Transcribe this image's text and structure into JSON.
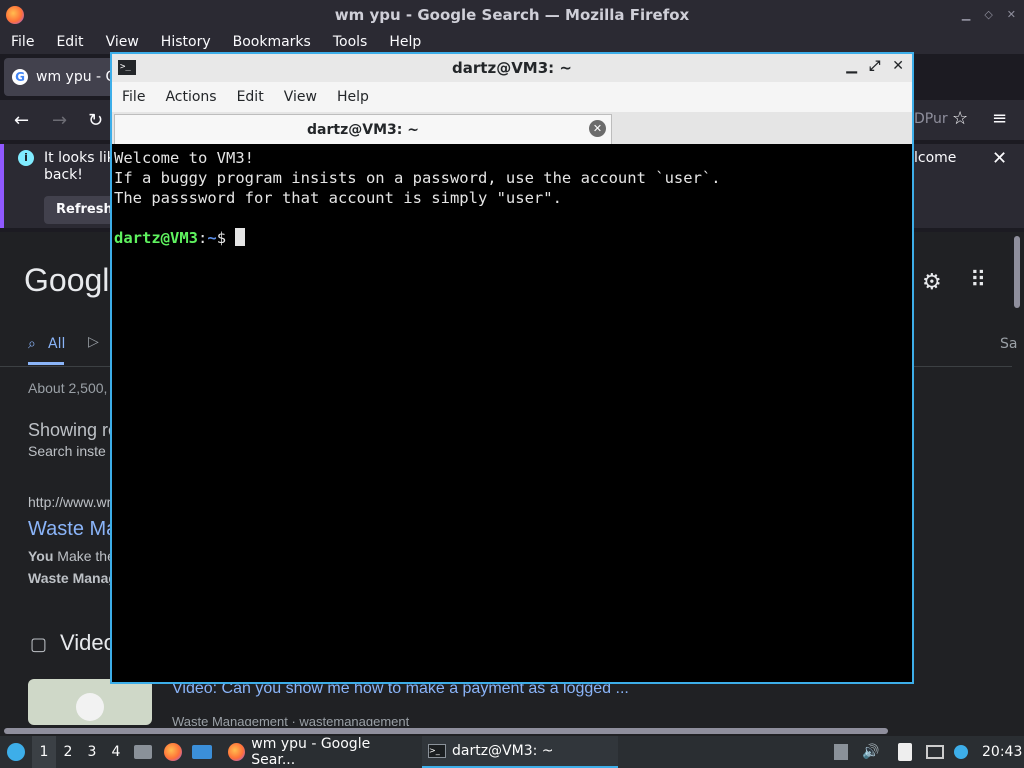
{
  "firefox": {
    "window_title": "wm ypu - Google Search — Mozilla Firefox",
    "menu": [
      "File",
      "Edit",
      "View",
      "History",
      "Bookmarks",
      "Tools",
      "Help"
    ],
    "tab_title": "wm ypu - Go",
    "address_tail": "DPur",
    "notice": {
      "text_line1": "It looks lik",
      "text_line2": "back!",
      "text_right": "lcome",
      "refresh_label": "Refresh"
    },
    "google": {
      "logo": "Google",
      "tab_all": "All",
      "tab_right": "Sa",
      "result_count": "About 2,500,",
      "showing": "Showing re",
      "search_instead": "Search inste",
      "result_url": "http://www.wr",
      "result_title": "Waste Ma",
      "snippet_1a": "You",
      "snippet_1b": " Make the",
      "snippet_2": "Waste Manag",
      "videos_heading": "Video",
      "video_title": "Video: Can you show me how to make a payment as a logged ...",
      "video_source": "Waste Management · wastemanagement"
    }
  },
  "terminal": {
    "window_title": "dartz@VM3: ~",
    "menu": [
      "File",
      "Actions",
      "Edit",
      "View",
      "Help"
    ],
    "tab_title": "dartz@VM3: ~",
    "lines": [
      "Welcome to VM3!",
      "If a buggy program insists on a password, use the account `user`.",
      "The passsword for that account is simply \"user\"."
    ],
    "prompt_user": "dartz@VM3",
    "prompt_sep": ":",
    "prompt_path": "~",
    "prompt_symbol": "$ "
  },
  "taskbar": {
    "desktops": [
      "1",
      "2",
      "3",
      "4"
    ],
    "tasks": [
      {
        "label": "wm ypu - Google Sear..."
      },
      {
        "label": "dartz@VM3: ~"
      }
    ],
    "clock": "20:43"
  }
}
